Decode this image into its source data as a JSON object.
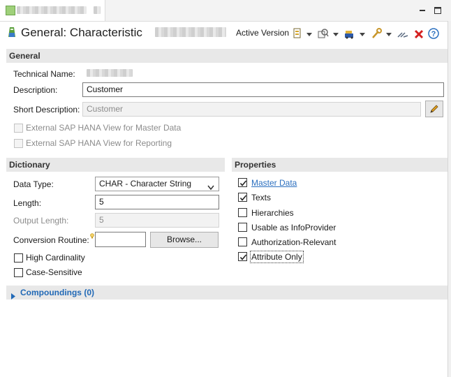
{
  "editor": {
    "title": "General: Characteristic",
    "version_label": "Active Version"
  },
  "sections": {
    "general": "General",
    "dictionary": "Dictionary",
    "properties": "Properties"
  },
  "general": {
    "technical_name_label": "Technical Name:",
    "description_label": "Description:",
    "description_value": "Customer",
    "short_description_label": "Short Description:",
    "short_description_value": "Customer",
    "hana_master_data_label": "External SAP HANA View for Master Data",
    "hana_reporting_label": "External SAP HANA View for Reporting"
  },
  "dictionary": {
    "data_type_label": "Data Type:",
    "data_type_value": "CHAR - Character String",
    "length_label": "Length:",
    "length_value": "5",
    "output_length_label": "Output Length:",
    "output_length_value": "5",
    "conversion_routine_label": "Conversion Routine:",
    "conversion_routine_value": "",
    "browse_label": "Browse...",
    "high_cardinality_label": "High Cardinality",
    "case_sensitive_label": "Case-Sensitive"
  },
  "properties": {
    "master_data_label": "Master Data",
    "texts_label": "Texts",
    "hierarchies_label": "Hierarchies",
    "infoprovider_label": "Usable as InfoProvider",
    "authorization_label": "Authorization-Relevant",
    "attribute_only_label": "Attribute Only"
  },
  "checkbox_states": {
    "hana_master_data": false,
    "hana_reporting": false,
    "high_cardinality": false,
    "case_sensitive": false,
    "master_data": true,
    "texts": true,
    "hierarchies": false,
    "infoprovider": false,
    "authorization": false,
    "attribute_only": true
  },
  "compoundings": {
    "label": "Compoundings (0)"
  },
  "icons": [
    "characteristic-icon",
    "minimize-icon",
    "maximize-icon",
    "version-icon",
    "where-used-icon",
    "transport-icon",
    "tools-icon",
    "activate-icon",
    "delete-icon",
    "help-icon",
    "edit-pencil-icon",
    "expand-arrow-icon"
  ],
  "colors": {
    "link": "#2b6fbf",
    "section_header_bg": "#e8e8e8",
    "delete_red": "#d42020",
    "help_blue": "#2a6fbf"
  }
}
